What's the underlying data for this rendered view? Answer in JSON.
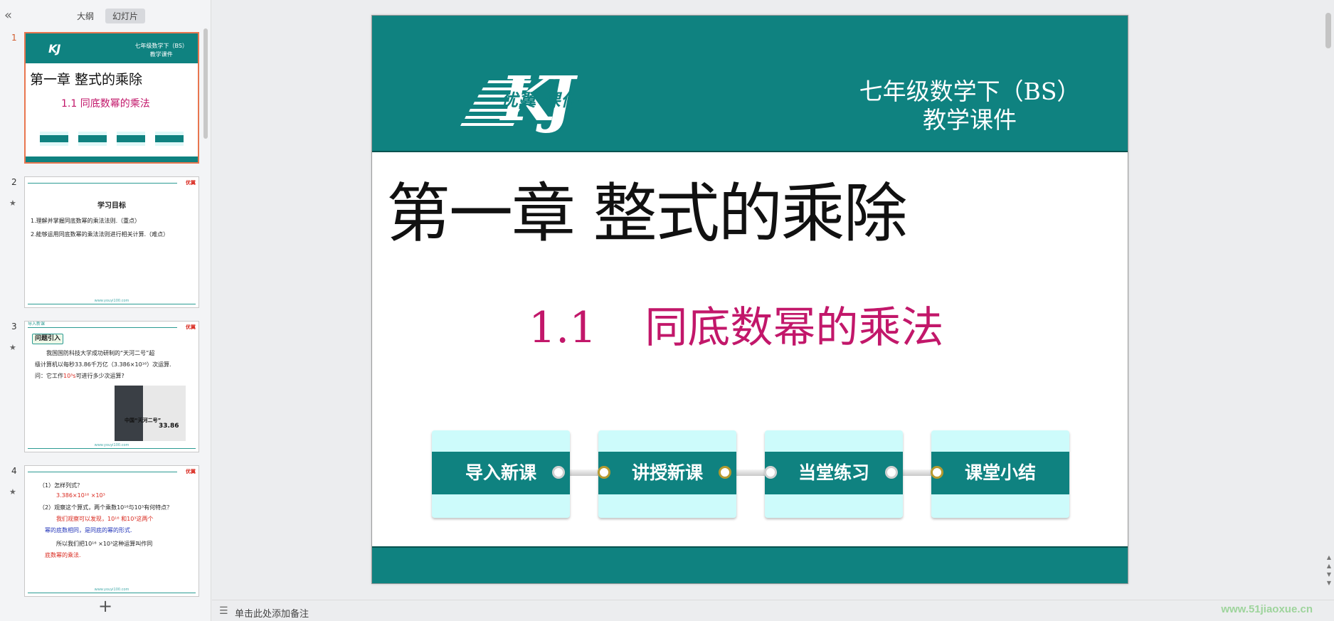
{
  "left_panel": {
    "collapse_icon": "«",
    "tabs": [
      {
        "label": "大纲"
      },
      {
        "label": "幻灯片"
      }
    ],
    "add_slide_icon": "+",
    "thumbnails": [
      {
        "number": "1"
      },
      {
        "number": "2",
        "star": "★"
      },
      {
        "number": "3",
        "star": "★"
      },
      {
        "number": "4",
        "star": "★"
      }
    ]
  },
  "thumb1": {
    "logo": "KJ",
    "grade": "七年级数学下（BS）",
    "course": "教学课件",
    "title": "第一章  整式的乘除",
    "subtitle": "1.1    同底数幂的乘法",
    "buttons": [
      "导入新课",
      "讲授新课",
      "当堂练习",
      "课堂小结"
    ]
  },
  "thumb2": {
    "brand": "优翼",
    "heading": "学习目标",
    "line1": "1.理解并掌握同底数幂的乘法法则.（重点）",
    "line2": "2.能够运用同底数幂的乘法法则进行相关计算.（难点）",
    "footer": "www.youyi100.com"
  },
  "thumb3": {
    "tag": "导入新课",
    "brand": "优翼",
    "badge": "问题引入",
    "line1": "我国国防科技大学成功研制的“天河二号”超",
    "line2": "级计算机以每秒33.86千万亿（3.386×10¹⁶）次运算.",
    "line3a": "问：它工作",
    "line3b": "10³s",
    "line3c": "可进行多少次运算?",
    "img_title": "中国“天河二号”",
    "img_value": "33.86",
    "footer": "www.youyi100.com"
  },
  "thumb4": {
    "brand": "优翼",
    "q1": "（1）怎样列式？",
    "q1a": "3.386×10¹⁶ ×10³",
    "q2": "（2）观察这个算式，两个乘数10¹⁶与10³有何特点？",
    "a2a": "我们观察可以发现，10¹⁶ 和10³这两个",
    "a2b": "幂的底数相同，是同底的幂的形式.",
    "a3a": "所以我们把10¹⁶ ×10³这种运算叫作同",
    "a3b": "底数幂的乘法.",
    "footer": "www.youyi100.com"
  },
  "slide": {
    "logo_letters": "KJ",
    "logo_text": "优翼 课件",
    "grade": "七年级数学下（BS）",
    "course": "教学课件",
    "chapter_title": "第一章  整式的乘除",
    "section_number": "1.1",
    "section_title": "同底数幂的乘法",
    "nav_buttons": [
      {
        "label": "导入新课"
      },
      {
        "label": "讲授新课"
      },
      {
        "label": "当堂练习"
      },
      {
        "label": "课堂小结"
      }
    ]
  },
  "notes": {
    "icon": "☰",
    "placeholder": "单击此处添加备注"
  },
  "watermark": "www.51jiaoxue.cn",
  "scroll_arrows": [
    "▲",
    "▲",
    "▼",
    "▼"
  ],
  "colors": {
    "teal": "#0f8280",
    "magenta": "#c2176a",
    "selected_border": "#e8764f",
    "light_cyan": "#cdfbfb"
  }
}
